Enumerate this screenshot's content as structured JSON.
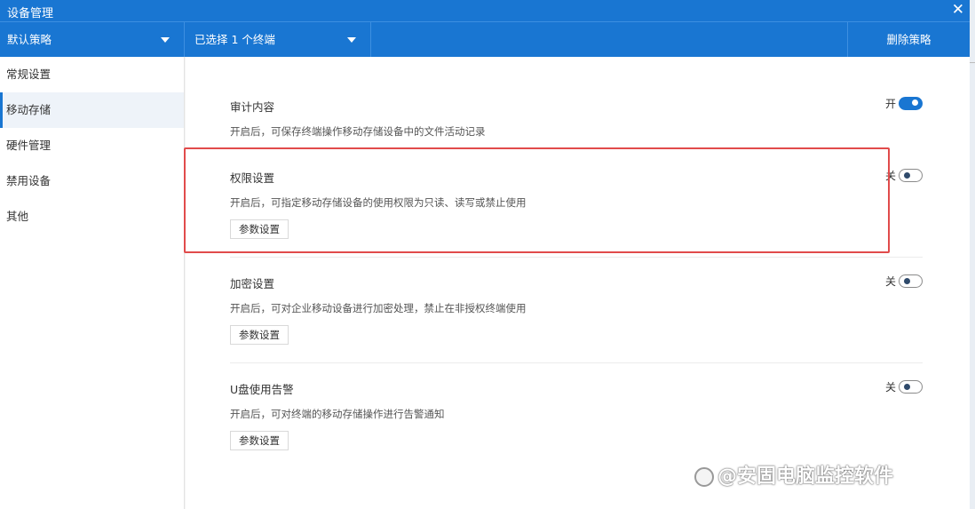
{
  "window": {
    "title": "设备管理",
    "close_icon": "close-icon"
  },
  "toolbar": {
    "policy_select": "默认策略",
    "terminal_select": "已选择 1 个终端",
    "delete_button": "删除策略"
  },
  "sidebar": {
    "items": [
      {
        "label": "常规设置",
        "active": false
      },
      {
        "label": "移动存储",
        "active": true
      },
      {
        "label": "硬件管理",
        "active": false
      },
      {
        "label": "禁用设备",
        "active": false
      },
      {
        "label": "其他",
        "active": false
      }
    ]
  },
  "sections": [
    {
      "title": "审计内容",
      "desc": "开启后，可保存终端操作移动存储设备中的文件活动记录",
      "toggle_label": "开",
      "toggle_on": true
    },
    {
      "title": "权限设置",
      "desc": "开启后，可指定移动存储设备的使用权限为只读、读写或禁止使用",
      "button": "参数设置",
      "toggle_label": "关",
      "toggle_on": false
    },
    {
      "title": "加密设置",
      "desc": "开启后，可对企业移动设备进行加密处理，禁止在非授权终端使用",
      "button": "参数设置",
      "toggle_label": "关",
      "toggle_on": false
    },
    {
      "title": "U盘使用告警",
      "desc": "开启后，可对终端的移动存储操作进行告警通知",
      "button": "参数设置",
      "toggle_label": "关",
      "toggle_on": false
    }
  ],
  "watermark": "@安固电脑监控软件",
  "colors": {
    "accent": "#1976d2",
    "highlight": "#e14b4b"
  }
}
